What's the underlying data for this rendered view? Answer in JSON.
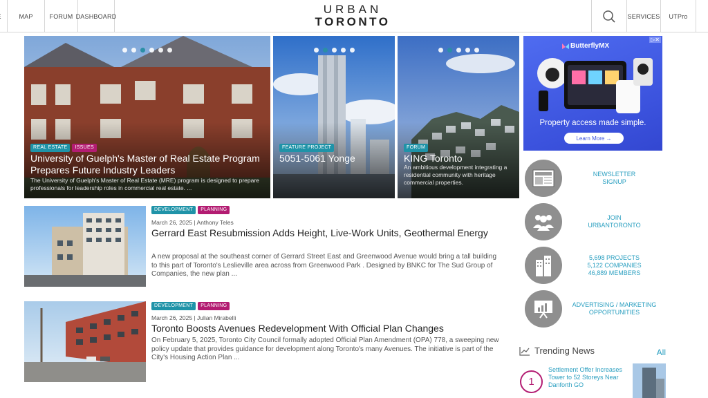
{
  "nav": {
    "items_left": [
      "GE",
      "MAP",
      "FORUM",
      "DASHBOARD"
    ],
    "logo_top": "URBAN",
    "logo_bottom": "TORONTO",
    "items_right": [
      "SERVICES",
      "UTPro"
    ]
  },
  "hero": [
    {
      "tags": [
        {
          "label": "REAL ESTATE",
          "color": "#1f93a8"
        },
        {
          "label": "ISSUES",
          "color": "#b31c72"
        }
      ],
      "title": "University of Guelph's Master of Real Estate Program Prepares Future Industry Leaders",
      "subtitle": "The University of Guelph's Master of Real Estate (MRE) program is designed to prepare professionals for leadership roles in commercial real estate. ...",
      "active_dot": 3,
      "dot_count": 6
    },
    {
      "tags": [
        {
          "label": "FEATURE PROJECT",
          "color": "#1f93a8"
        }
      ],
      "title": "5051-5061 Yonge",
      "subtitle": "",
      "active_dot": 2,
      "dot_count": 5
    },
    {
      "tags": [
        {
          "label": "FORUM",
          "color": "#1f93a8"
        }
      ],
      "title": "KING Toronto",
      "subtitle": "An ambitious development integrating a residential community with heritage commercial properties.",
      "active_dot": 2,
      "dot_count": 5
    }
  ],
  "ad": {
    "brand": "ButterflyMX",
    "tagline": "Property access made simple.",
    "button": "Learn More →",
    "badge": "▷✕"
  },
  "sidebar": {
    "newsletter": [
      "NEWSLETTER",
      "SIGNUP"
    ],
    "join": [
      "JOIN",
      "URBANTORONTO"
    ],
    "stats": [
      "5,698 PROJECTS",
      "5,122 COMPANIES",
      "46,889 MEMBERS"
    ],
    "advertising": [
      "ADVERTISING / MARKETING",
      "OPPORTUNITIES"
    ],
    "news_icon_label": "NEWS"
  },
  "articles": [
    {
      "tags": [
        "DEVELOPMENT",
        "PLANNING"
      ],
      "meta": "March 26, 2025 | Anthony Teles",
      "title": "Gerrard East Resubmission Adds Height, Live-Work Units, Geothermal Energy",
      "excerpt": "A new proposal at the southeast corner of Gerrard Street East and Greenwood Avenue would bring a tall building to this part of Toronto's Leslieville area across from Greenwood Park . Designed by BNKC for The Sud Group of Companies, the new plan ..."
    },
    {
      "tags": [
        "DEVELOPMENT",
        "PLANNING"
      ],
      "meta": "March 26, 2025 | Julian Mirabelli",
      "title": "Toronto Boosts Avenues Redevelopment With Official Plan Changes",
      "excerpt": "On February 5, 2025, Toronto City Council formally adopted Official Plan Amendment (OPA) 778, a sweeping new policy update that provides guidance for development along Toronto's many Avenues. The initiative is part of the City's Housing Action Plan ..."
    }
  ],
  "trending": {
    "title": "Trending News",
    "all_label": "All",
    "items": [
      {
        "rank": "1",
        "title": "Settlement Offer Increases Tower to 52 Storeys Near Danforth GO"
      }
    ]
  }
}
